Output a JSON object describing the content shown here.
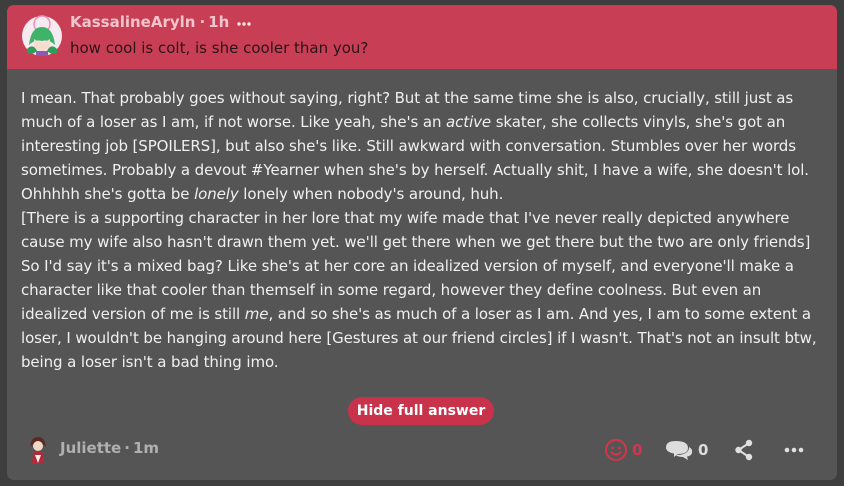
{
  "question": {
    "asker_name": "KassalineAryln",
    "separator": "·",
    "time": "1h",
    "more_icon": "ellipsis-icon",
    "text": "how cool is colt, is she cooler than you?"
  },
  "answer": {
    "p1_a": "I mean. That probably goes without saying, right? But at the same time she is also, crucially, still just as much of a loser as I am, if not worse. Like yeah, she's an ",
    "p1_em": "active",
    "p1_b": " skater, she collects vinyls, she's got an interesting job [SPOILERS], but also she's like. Still awkward with conversation. Stumbles over her words sometimes. Probably a devout #Yearner when she's by herself. Actually shit, I have a wife, she doesn't lol. Ohhhhh she's gotta be ",
    "p1_em2": "lonely",
    "p1_c": " lonely when nobody's around, huh.",
    "p2": "[There is a supporting character in her lore that my wife made that I've never really depicted anywhere cause my wife also hasn't drawn them yet. we'll get there when we get there but the two are only friends]",
    "p3_a": "So I'd say it's a mixed bag? Like she's at her core an idealized version of myself, and everyone'll make a character like that cooler than themself in some regard, however they define coolness. But even an idealized version of me is still ",
    "p3_em": "me",
    "p3_b": ", and so she's as much of a loser as I am. And yes, I am to some extent a loser, I wouldn't be hanging around here [Gestures at our friend circles] if I wasn't. That's not an insult btw, being a loser isn't a bad thing imo."
  },
  "hide_button_label": "Hide full answer",
  "footer": {
    "answerer_name": "Juliette",
    "separator": "·",
    "time": "1m",
    "reactions_count": "0",
    "comments_count": "0",
    "icons": [
      "smiley-icon",
      "comment-bubbles-icon",
      "share-icon",
      "ellipsis-icon"
    ]
  },
  "colors": {
    "question_bg": "#c83f55",
    "card_bg": "#555555",
    "page_bg": "#3e3e3e",
    "accent": "#c8324a",
    "reaction_color": "#d5344c"
  }
}
